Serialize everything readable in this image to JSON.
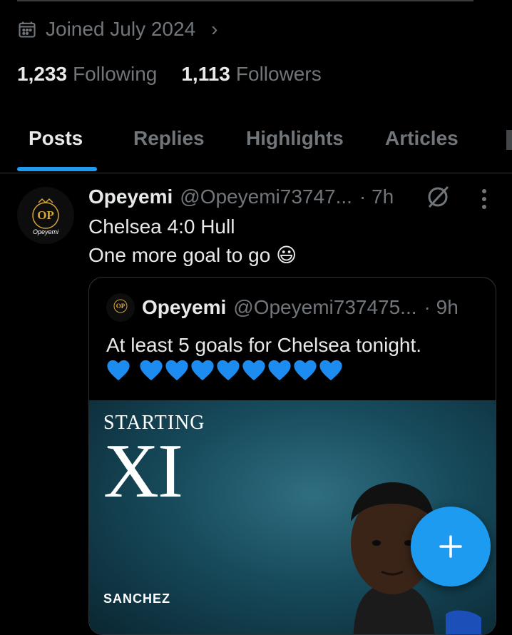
{
  "profile": {
    "joined": "Joined July 2024",
    "following_count": "1,233",
    "following_label": "Following",
    "followers_count": "1,113",
    "followers_label": "Followers"
  },
  "tabs": [
    {
      "label": "Posts",
      "active": true
    },
    {
      "label": "Replies",
      "active": false
    },
    {
      "label": "Highlights",
      "active": false
    },
    {
      "label": "Articles",
      "active": false
    }
  ],
  "post": {
    "name": "Opeyemi",
    "handle": "@Opeyemi73747...",
    "time": "· 7h",
    "line1": "Chelsea 4:0 Hull",
    "line2": "One more goal to go 😃",
    "avatar_text": "Opeyemi",
    "quote": {
      "name": "Opeyemi",
      "handle": "@Opeyemi737475...",
      "time": "· 9h",
      "text": "At least 5 goals for Chelsea tonight.",
      "heart_count": 9,
      "media": {
        "starting": "STARTING",
        "xi": "XI",
        "player_name": "SANCHEZ"
      }
    }
  },
  "colors": {
    "accent": "#1d9bf0",
    "text_primary": "#e7e9ea",
    "text_secondary": "#71767b",
    "border": "#2f3336",
    "background": "#000000"
  },
  "icons": {
    "calendar": "calendar-icon",
    "chevron": "chevron-right-icon",
    "grok": "grok-icon",
    "more": "more-vertical-icon",
    "heart": "blue-heart-icon",
    "compose": "plus-icon"
  }
}
